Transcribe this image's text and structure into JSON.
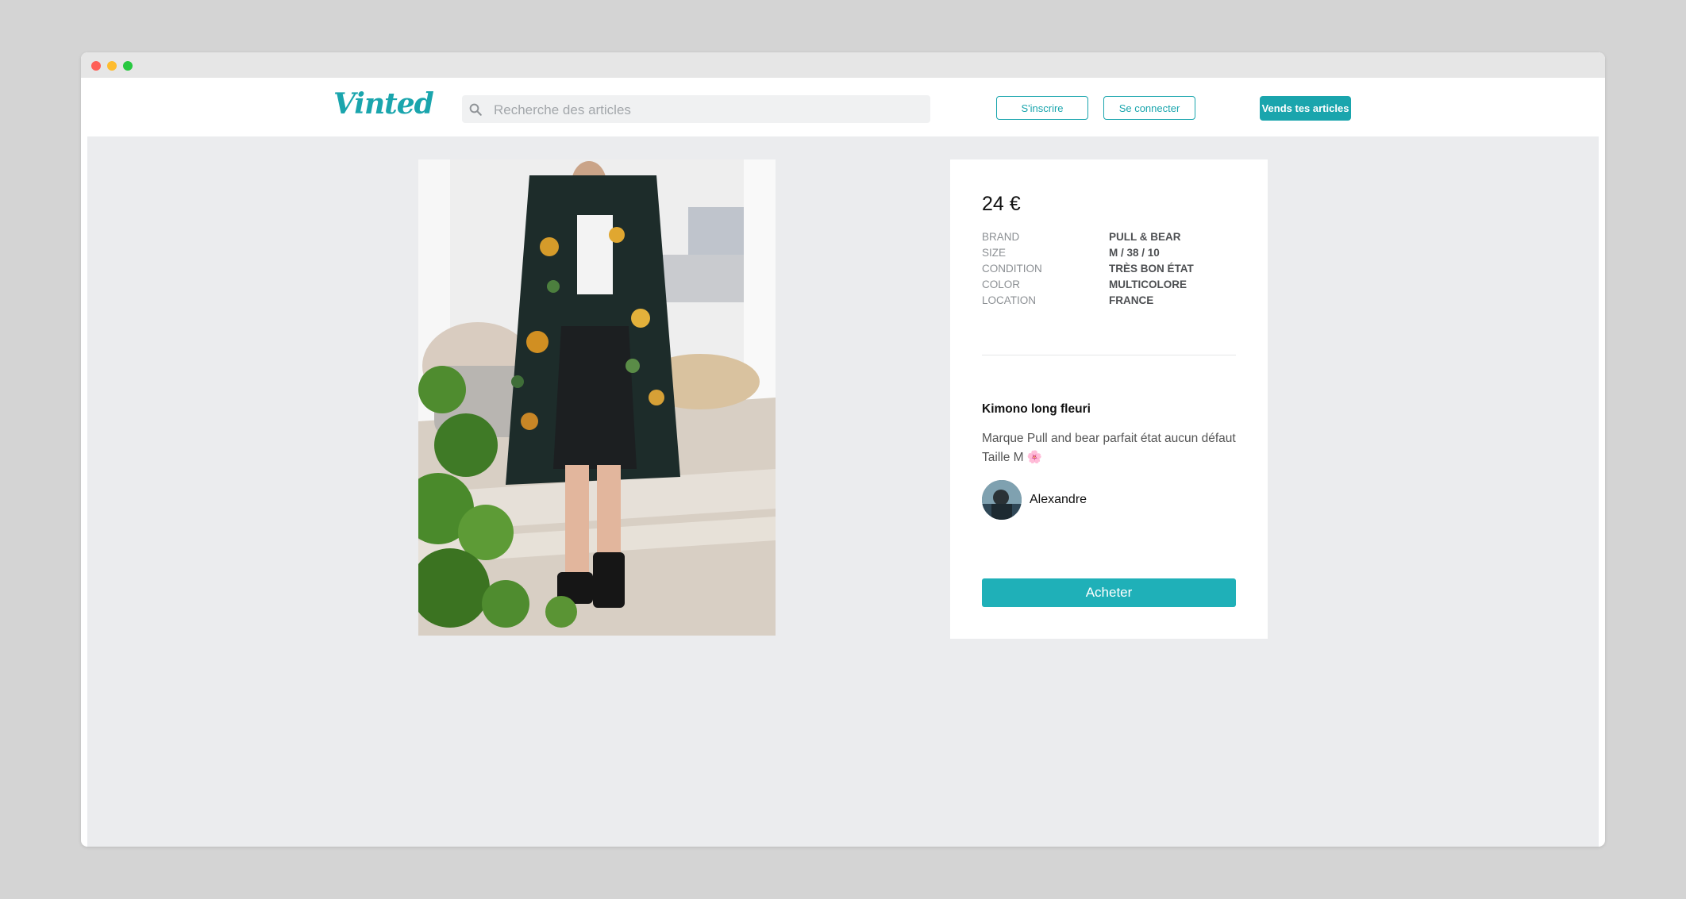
{
  "header": {
    "logo": "Vinted",
    "search_placeholder": "Recherche des articles",
    "signup_label": "S'inscrire",
    "login_label": "Se connecter",
    "sell_label": "Vends tes articles"
  },
  "item": {
    "price": "24 €",
    "details": [
      {
        "label": "BRAND",
        "value": "PULL & BEAR"
      },
      {
        "label": "SIZE",
        "value": "M / 38 / 10"
      },
      {
        "label": "CONDITION",
        "value": "TRÈS BON ÉTAT"
      },
      {
        "label": "COLOR",
        "value": "MULTICOLORE"
      },
      {
        "label": "LOCATION",
        "value": "FRANCE"
      }
    ],
    "title": "Kimono long fleuri",
    "description": "Marque Pull and bear parfait état aucun défaut Taille M 🌸",
    "seller_name": "Alexandre",
    "buy_label": "Acheter"
  },
  "colors": {
    "brand": "#1aa5ad",
    "buy_button": "#1fb0b8",
    "page_background": "#ebecee"
  },
  "icons": {
    "search": "search-icon",
    "window_controls": [
      "close-dot",
      "minimize-dot",
      "zoom-dot"
    ]
  }
}
